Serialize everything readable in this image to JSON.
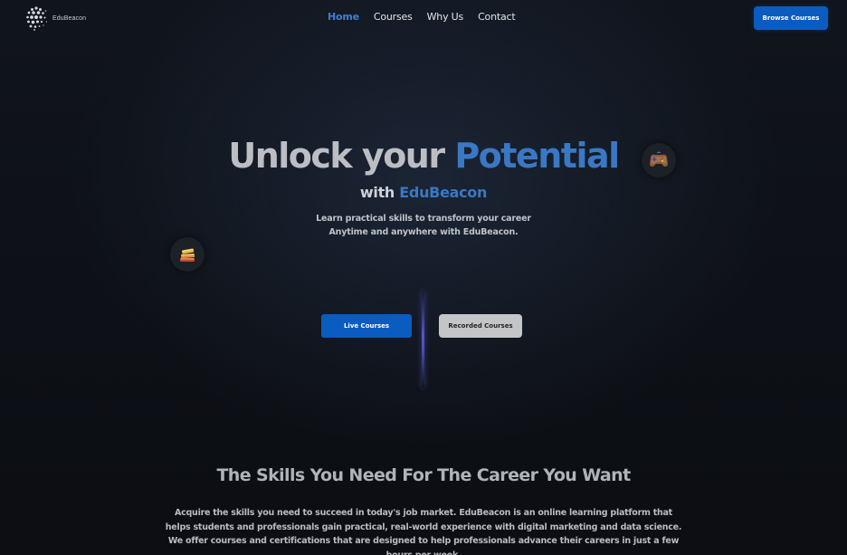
{
  "header": {
    "brand": "EduBeacon",
    "logo_icon": "dotted-globe-logo-icon",
    "nav": [
      {
        "label": "Home",
        "active": true
      },
      {
        "label": "Courses",
        "active": false
      },
      {
        "label": "Why Us",
        "active": false
      },
      {
        "label": "Contact",
        "active": false
      }
    ],
    "cta_label": "Browse Courses"
  },
  "hero": {
    "title_part1": "Unlock your ",
    "title_accent": "Potential",
    "subtitle_part1": "with ",
    "subtitle_accent": "EduBeacon",
    "description_lines": [
      "Learn practical skills to transform your career",
      "Anytime and anywhere with EduBeacon."
    ],
    "buttons": {
      "live": "Live Courses",
      "recorded": "Recorded Courses"
    },
    "floating_icons": [
      "gamepad-icon",
      "books-icon"
    ]
  },
  "skills": {
    "heading": "The Skills You Need For The Career You Want",
    "body": "Acquire the skills you need to succeed in today's job market. EduBeacon is an online learning platform that helps students and professionals gain practical, real-world experience with digital marketing and data science. We offer courses and certifications that are designed to help professionals advance their careers in just a few hours per week."
  },
  "colors": {
    "accent": "#3a78c4",
    "primary_button": "#0a5cc0",
    "background": "#0d1016",
    "secondary_button": "#c4c5c7"
  }
}
